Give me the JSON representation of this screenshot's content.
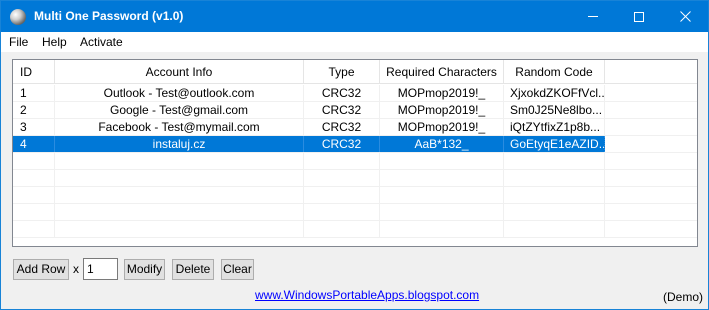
{
  "window": {
    "title": "Multi One Password (v1.0)"
  },
  "menu": {
    "file": "File",
    "help": "Help",
    "activate": "Activate"
  },
  "table": {
    "columns": [
      "ID",
      "Account Info",
      "Type",
      "Required Characters",
      "Random Code"
    ],
    "rows": [
      {
        "id": "1",
        "account": "Outlook - Test@outlook.com",
        "type": "CRC32",
        "required": "MOPmop2019!_",
        "random": "XjxokdZKOFfVcl..."
      },
      {
        "id": "2",
        "account": "Google - Test@gmail.com",
        "type": "CRC32",
        "required": "MOPmop2019!_",
        "random": "Sm0J25Ne8lbo..."
      },
      {
        "id": "3",
        "account": "Facebook - Test@mymail.com",
        "type": "CRC32",
        "required": "MOPmop2019!_",
        "random": "iQtZYtfixZ1p8b..."
      },
      {
        "id": "4",
        "account": "instaluj.cz",
        "type": "CRC32",
        "required": "AaB*132_",
        "random": "GoEtyqE1eAZID..."
      }
    ],
    "selected_row": "4"
  },
  "controls": {
    "add_row": "Add Row",
    "x_label": "x",
    "count_value": "1",
    "modify": "Modify",
    "delete": "Delete",
    "clear": "Clear"
  },
  "footer": {
    "link": "www.WindowsPortableApps.blogspot.com",
    "status": "(Demo)"
  },
  "colors": {
    "titlebar": "#0078d7",
    "selection": "#0078d7",
    "link": "#0000ff"
  }
}
